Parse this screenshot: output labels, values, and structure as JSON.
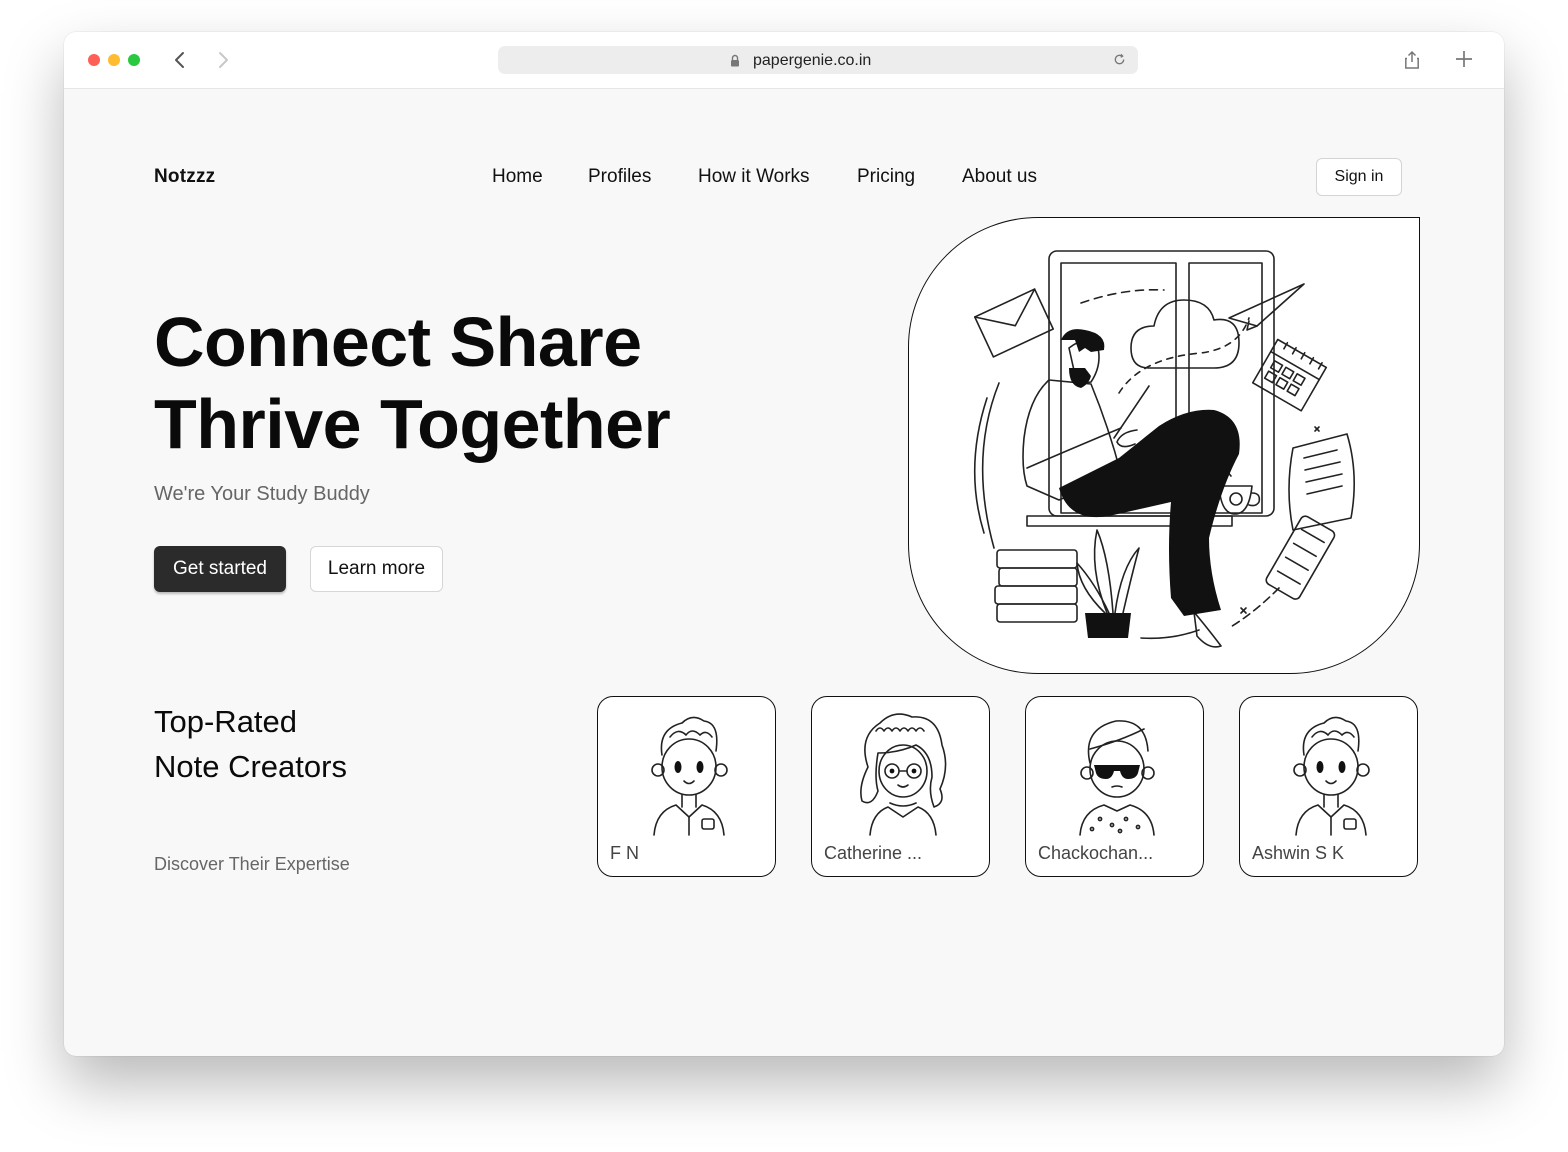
{
  "browser": {
    "url": "papergenie.co.in"
  },
  "nav": {
    "brand": "Notzzz",
    "links": [
      "Home",
      "Profiles",
      "How it Works",
      "Pricing",
      "About us"
    ],
    "signin_label": "Sign in"
  },
  "hero": {
    "title_line1": "Connect Share",
    "title_line2": "Thrive Together",
    "subtitle": "We're Your Study Buddy",
    "primary_button": "Get started",
    "secondary_button": "Learn more"
  },
  "creators": {
    "title_line1": "Top-Rated",
    "title_line2": "Note Creators",
    "subtitle": "Discover Their Expertise",
    "cards": [
      {
        "name": "F N",
        "avatar": "boy-avatar-icon"
      },
      {
        "name": "Catherine ...",
        "avatar": "curly-hair-glasses-avatar-icon"
      },
      {
        "name": "Chackochan...",
        "avatar": "sunglasses-avatar-icon"
      },
      {
        "name": "Ashwin S K",
        "avatar": "boy-avatar-icon"
      }
    ]
  },
  "colors": {
    "page_bg": "#f8f8f8",
    "primary_button_bg": "#2b2b2b",
    "text_muted": "#666666"
  }
}
